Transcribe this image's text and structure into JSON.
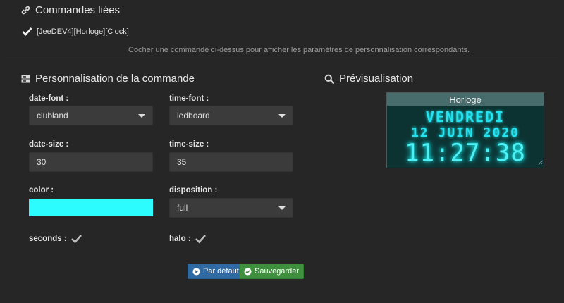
{
  "linked": {
    "title": "Commandes liées",
    "command_label": "[JeeDEV4][Horloge][Clock]",
    "hint": "Cocher une commande ci-dessus pour afficher les paramètres de personnalisation correspondants."
  },
  "custom": {
    "title": "Personnalisation de la commande",
    "date_font": {
      "label": "date-font :",
      "value": "clubland"
    },
    "time_font": {
      "label": "time-font :",
      "value": "ledboard"
    },
    "date_size": {
      "label": "date-size :",
      "value": "30"
    },
    "time_size": {
      "label": "time-size :",
      "value": "35"
    },
    "color": {
      "label": "color :",
      "value": "#2dfcff"
    },
    "disposition": {
      "label": "disposition :",
      "value": "full"
    },
    "seconds": {
      "label": "seconds :",
      "checked": true
    },
    "halo": {
      "label": "halo :",
      "checked": true
    },
    "buttons": {
      "default": "Par défaut",
      "save": "Sauvegarder"
    }
  },
  "preview": {
    "title": "Prévisualisation",
    "widget_title": "Horloge",
    "date_line1": "VENDREDI",
    "date_line2": "12 JUIN 2020",
    "time": "11:27:38"
  }
}
